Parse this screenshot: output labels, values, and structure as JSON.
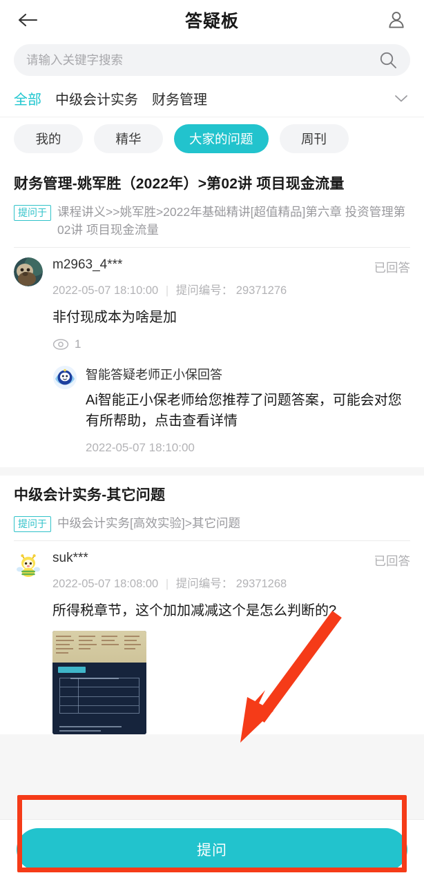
{
  "header": {
    "title": "答疑板",
    "back_icon": "arrow-left-icon",
    "user_icon": "person-icon"
  },
  "search": {
    "placeholder": "请输入关键字搜索",
    "value": "",
    "icon": "search-icon"
  },
  "categories": {
    "items": [
      {
        "label": "全部",
        "active": true
      },
      {
        "label": "中级会计实务",
        "active": false
      },
      {
        "label": "财务管理",
        "active": false
      }
    ],
    "expand_icon": "chevron-down-icon"
  },
  "chips": [
    {
      "label": "我的",
      "active": false
    },
    {
      "label": "精华",
      "active": false
    },
    {
      "label": "大家的问题",
      "active": true
    },
    {
      "label": "周刊",
      "active": false
    }
  ],
  "posts": [
    {
      "title": "财务管理-姚军胜（2022年）>第02讲 项目现金流量",
      "asked_label": "提问于",
      "asked_path": "课程讲义>>姚军胜>2022年基础精讲[超值精品]第六章 投资管理第02讲 项目现金流量",
      "question": {
        "avatar": "user-photo-avatar",
        "username": "m2963_4***",
        "status": "已回答",
        "time": "2022-05-07 18:10:00",
        "id_label": "提问编号：",
        "id_value": "29371276",
        "text": "非付现成本为啥是加",
        "views_icon": "eye-icon",
        "views": "1"
      },
      "answer": {
        "avatar": "robot-mascot-avatar",
        "name": "智能答疑老师正小保回答",
        "text": "Ai智能正小保老师给您推荐了问题答案，可能会对您有所帮助，点击查看详情",
        "time": "2022-05-07 18:10:00"
      }
    },
    {
      "title": "中级会计实务-其它问题",
      "asked_label": "提问于",
      "asked_path": "中级会计实务[高效实验]>其它问题",
      "question": {
        "avatar": "bee-mascot-avatar",
        "username": "suk***",
        "status": "已回答",
        "time": "2022-05-07 18:08:00",
        "id_label": "提问编号：",
        "id_value": "29371268",
        "text": "所得税章节，这个加加减减这个是怎么判断的?",
        "attachment": "question-screenshot-thumbnail"
      }
    }
  ],
  "bottom": {
    "ask_label": "提问"
  },
  "annotations": {
    "highlight_box": "red-rectangle-highlight",
    "arrow": "red-arrow-pointing-down-left"
  },
  "colors": {
    "accent": "#22c3cd",
    "annotation": "#f53b18",
    "text_primary": "#1a1a1a",
    "text_muted": "#b3b3b6"
  }
}
